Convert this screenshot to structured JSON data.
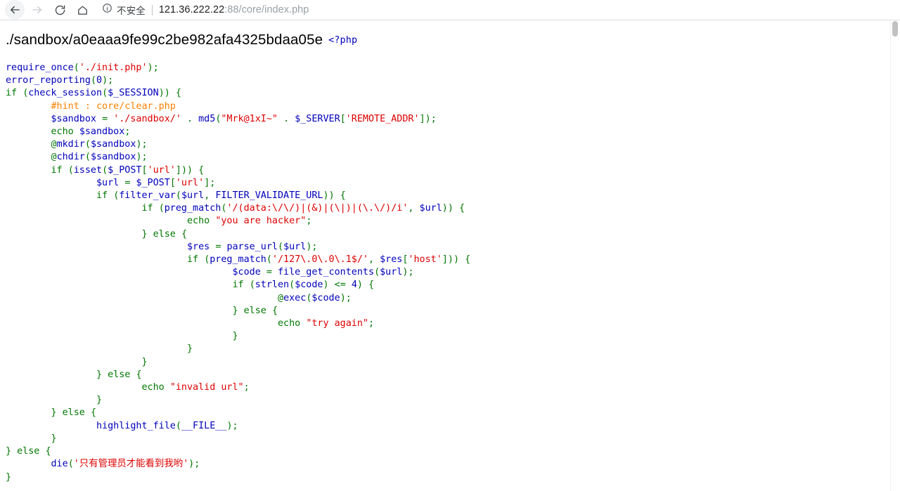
{
  "browser": {
    "nav": {
      "back_label": "Back",
      "back_icon": "arrow-left-icon",
      "forward_label": "Forward",
      "forward_icon": "arrow-right-icon",
      "reload_label": "Reload",
      "reload_icon": "reload-icon",
      "home_label": "Home",
      "home_icon": "home-icon"
    },
    "omnibox": {
      "security_icon": "info-circle-icon",
      "security_text": "不安全",
      "url_host": "121.36.222.22",
      "url_path": ":88/core/index.php",
      "full_url": "121.36.222.22:88/core/index.php"
    },
    "scrollbar": {
      "name": "vertical-scrollbar"
    }
  },
  "page": {
    "sandbox_path": "./sandbox/a0eaaa9fe99c2be982afa4325bdaa05e",
    "php_open_tag": "<?php",
    "colors": {
      "keyword": "#0000BB",
      "string": "#DD0000",
      "comment": "#FF8000",
      "default": "#007700",
      "background": "#FFFFFF"
    },
    "code_lines": [
      "require_once('./init.php');",
      "error_reporting(0);",
      "if (check_session($_SESSION)) {",
      "        #hint : core/clear.php",
      "        $sandbox = './sandbox/' . md5(\"Mrk@1xI~\" . $_SERVER['REMOTE_ADDR']);",
      "        echo $sandbox;",
      "        @mkdir($sandbox);",
      "        @chdir($sandbox);",
      "        if (isset($_POST['url'])) {",
      "                $url = $_POST['url'];",
      "                if (filter_var($url, FILTER_VALIDATE_URL)) {",
      "                        if (preg_match('/(data:\\/\\/)|(&)|(\\|)|(\\.\\/)/i', $url)) {",
      "                                echo \"you are hacker\";",
      "                        } else {",
      "                                $res = parse_url($url);",
      "                                if (preg_match('/127\\.0\\.0\\.1$/', $res['host'])) {",
      "                                        $code = file_get_contents($url);",
      "                                        if (strlen($code) <= 4) {",
      "                                                @exec($code);",
      "                                        } else {",
      "                                                echo \"try again\";",
      "                                        }",
      "                                }",
      "                        }",
      "                } else {",
      "                        echo \"invalid url\";",
      "                }",
      "        } else {",
      "                highlight_file(__FILE__);",
      "        }",
      "} else {",
      "        die('只有管理员才能看到我哟');",
      "}"
    ]
  }
}
